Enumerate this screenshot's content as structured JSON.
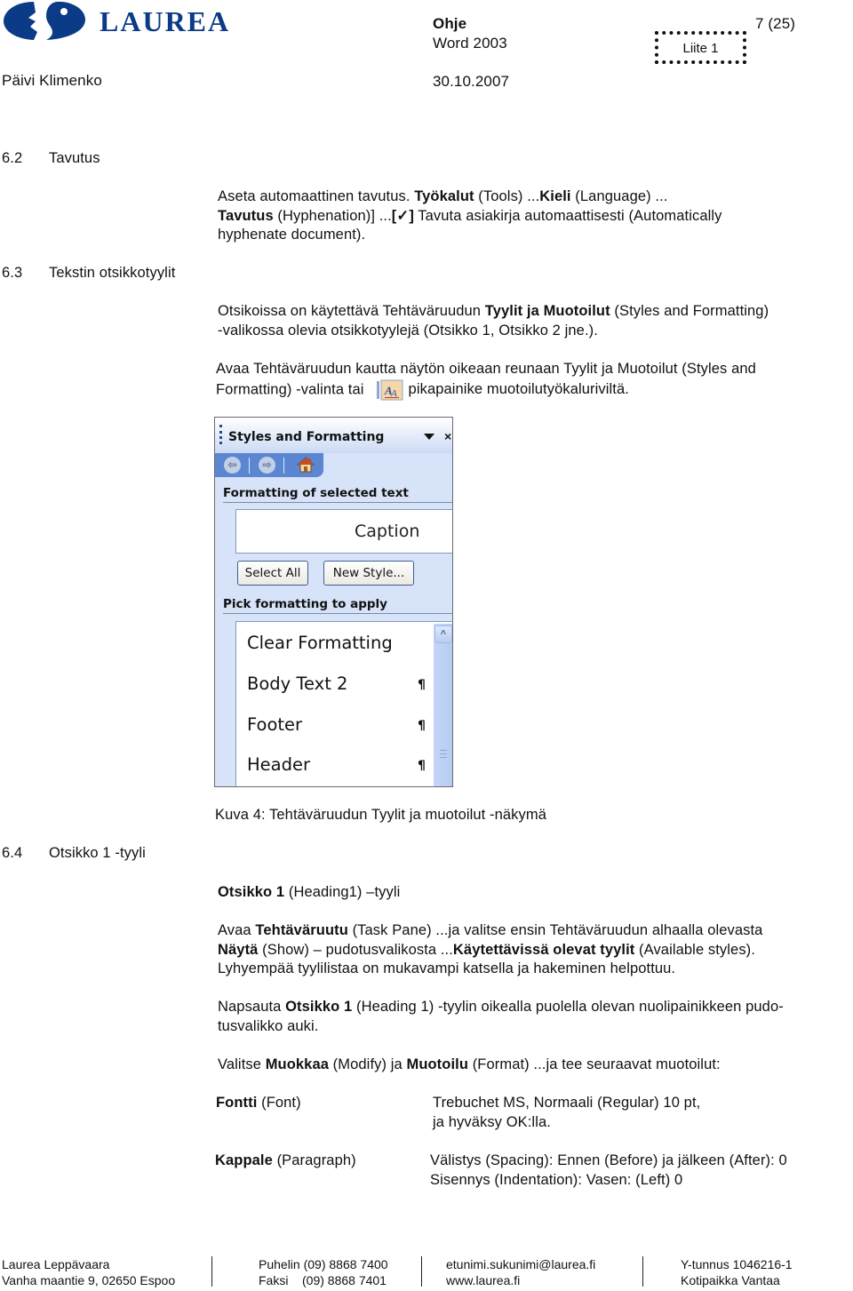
{
  "header": {
    "organization": "LAUREA",
    "author": "Päivi Klimenko",
    "doc_title": "Ohje",
    "doc_subtitle": "Word 2003",
    "date": "30.10.2007",
    "attachment_label": "Liite 1",
    "page_indicator": "7 (25)",
    "brand_color": "#0b3a86"
  },
  "sections": {
    "s62": {
      "number": "6.2",
      "title": "Tavutus"
    },
    "s63": {
      "number": "6.3",
      "title": "Tekstin otsikkotyylit"
    },
    "s64": {
      "number": "6.4",
      "title": "Otsikko 1 -tyyli"
    }
  },
  "hyphenation": {
    "l1_a": "Aseta automaattinen tavutus. ",
    "l1_b": "Työkalut",
    "l1_c": " (Tools) ...",
    "l1_d": "Kieli",
    "l1_e": " (Language) ...",
    "l2_a": "Tavutus",
    "l2_b": " (Hyphenation)] ...",
    "l2_c": "[✓]",
    "l2_d": " Tavuta asiakirja automaattisesti (Automatically",
    "l3": "hyphenate document)."
  },
  "headings_para1": {
    "l1_a": "Otsikoissa on käytettävä Tehtäväruudun ",
    "l1_b": "Tyylit ja Muotoilut",
    "l1_c": " (Styles and Formatting)",
    "l2": "-valikossa olevia otsikkotyylejä (Otsikko 1, Otsikko 2 jne.)."
  },
  "headings_para2": {
    "l1": "Avaa Tehtäväruudun kautta näytön oikeaan reunaan Tyylit ja Muotoilut (Styles and",
    "l2_a": "Formatting) -valinta tai",
    "l2_b": "pikapainike muotoilutyökaluriviltä."
  },
  "task_pane": {
    "title": "Styles and Formatting",
    "dropdown_icon": "triangle-down",
    "close_icon": "×",
    "back_icon": "⇦",
    "forward_icon": "⇨",
    "section_selected": "Formatting of selected text",
    "current_style": "Caption",
    "select_all_label": "Select All",
    "new_style_label": "New Style...",
    "section_pick": "Pick formatting to apply",
    "styles": [
      {
        "name": "Clear Formatting",
        "mark": ""
      },
      {
        "name": "Body Text 2",
        "mark": "¶"
      },
      {
        "name": "Footer",
        "mark": "¶"
      },
      {
        "name": "Header",
        "mark": "¶"
      }
    ],
    "scroll_up_icon": "^"
  },
  "figure_caption": "Kuva 4: Tehtäväruudun Tyylit ja muotoilut -näkymä",
  "heading1": {
    "intro_a": "Otsikko 1",
    "intro_b": " (Heading1) –tyyli",
    "p1_l1_a": "Avaa ",
    "p1_l1_b": "Tehtäväruutu",
    "p1_l1_c": " (Task Pane) ...ja valitse ensin Tehtäväruudun alhaalla olevasta",
    "p1_l2_a": "Näytä",
    "p1_l2_b": " (Show) – pudotusvalikosta ...",
    "p1_l2_c": "Käytettävissä olevat tyylit",
    "p1_l2_d": " (Available styles).",
    "p1_l3": "Lyhyempää tyylilistaa on mukavampi katsella ja hakeminen helpottuu.",
    "p2_l1_a": "Napsauta ",
    "p2_l1_b": "Otsikko 1",
    "p2_l1_c": " (Heading 1) -tyylin oikealla puolella olevan nuolipainikkeen pudo-",
    "p2_l2": "tusvalikko auki.",
    "p3_a": "Valitse ",
    "p3_b": "Muokkaa",
    "p3_c": " (Modify) ja ",
    "p3_d": "Muotoilu",
    "p3_e": " (Format) ...ja tee seuraavat muotoilut:",
    "settings": [
      {
        "label_bold": "Fontti",
        "label_rest": " (Font)",
        "value_l1": "Trebuchet MS, Normaali (Regular) 10 pt,",
        "value_l2": "ja hyväksy OK:lla."
      },
      {
        "label_bold": "Kappale",
        "label_rest": " (Paragraph)",
        "value_l1": "Välistys (Spacing): Ennen (Before) ja jälkeen (After): 0",
        "value_l2": "Sisennys (Indentation): Vasen: (Left) 0"
      }
    ]
  },
  "footer": {
    "col1_l1": "Laurea Leppävaara",
    "col1_l2": "Vanha maantie 9, 02650 Espoo",
    "col2_l1": "Puhelin (09) 8868 7400",
    "col2_l2": "Faksi    (09) 8868 7401",
    "col3_l1": "etunimi.sukunimi@laurea.fi",
    "col3_l2": "www.laurea.fi",
    "col4_l1": "Y-tunnus 1046216-1",
    "col4_l2": "Kotipaikka Vantaa"
  }
}
